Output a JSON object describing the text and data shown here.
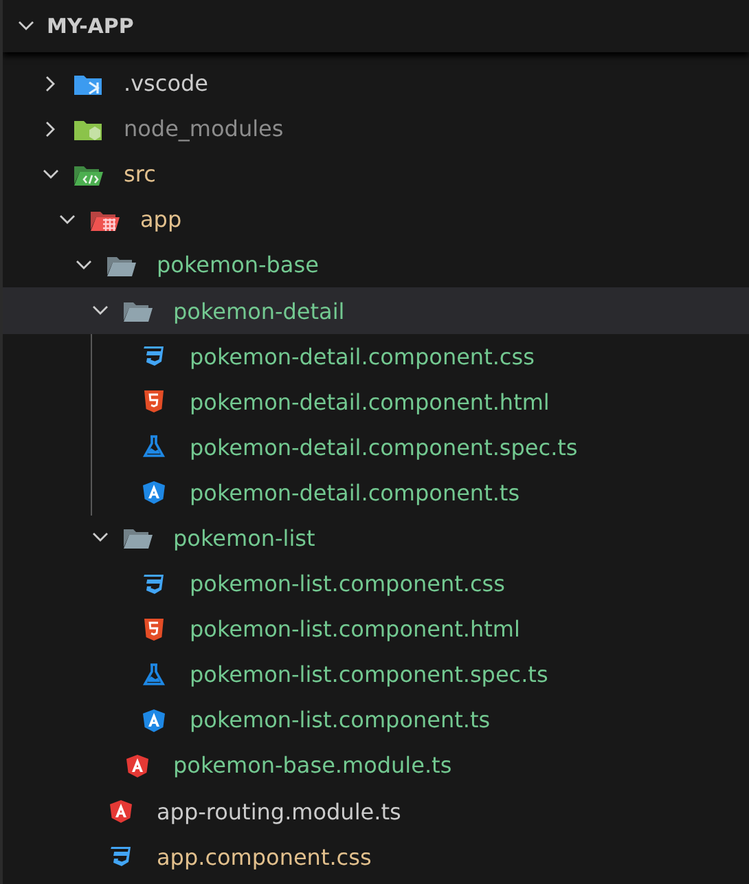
{
  "explorer": {
    "title": "MY-APP",
    "expanded": true
  },
  "tree": [
    {
      "name": ".vscode",
      "kind": "vscode-folder",
      "expanded": false,
      "selected": false,
      "color": "#cccccc"
    },
    {
      "name": "node_modules",
      "kind": "node-folder",
      "expanded": false,
      "selected": false,
      "color": "#8c8c8c"
    },
    {
      "name": "src",
      "kind": "src-folder",
      "expanded": true,
      "selected": false,
      "color": "#e2c08d",
      "children": [
        {
          "name": "app",
          "kind": "app-folder",
          "expanded": true,
          "selected": false,
          "color": "#e2c08d",
          "children": [
            {
              "name": "pokemon-base",
              "kind": "folder",
              "expanded": true,
              "selected": false,
              "color": "#73c991",
              "children": [
                {
                  "name": "pokemon-detail",
                  "kind": "folder",
                  "expanded": true,
                  "selected": true,
                  "color": "#73c991",
                  "children": [
                    {
                      "name": "pokemon-detail.component.css",
                      "kind": "css-file",
                      "selected": false,
                      "color": "#73c991"
                    },
                    {
                      "name": "pokemon-detail.component.html",
                      "kind": "html-file",
                      "selected": false,
                      "color": "#73c991"
                    },
                    {
                      "name": "pokemon-detail.component.spec.ts",
                      "kind": "spec-file",
                      "selected": false,
                      "color": "#73c991"
                    },
                    {
                      "name": "pokemon-detail.component.ts",
                      "kind": "component-file",
                      "selected": false,
                      "color": "#73c991"
                    }
                  ]
                },
                {
                  "name": "pokemon-list",
                  "kind": "folder",
                  "expanded": true,
                  "selected": false,
                  "color": "#73c991",
                  "children": [
                    {
                      "name": "pokemon-list.component.css",
                      "kind": "css-file",
                      "selected": false,
                      "color": "#73c991"
                    },
                    {
                      "name": "pokemon-list.component.html",
                      "kind": "html-file",
                      "selected": false,
                      "color": "#73c991"
                    },
                    {
                      "name": "pokemon-list.component.spec.ts",
                      "kind": "spec-file",
                      "selected": false,
                      "color": "#73c991"
                    },
                    {
                      "name": "pokemon-list.component.ts",
                      "kind": "component-file",
                      "selected": false,
                      "color": "#73c991"
                    }
                  ]
                },
                {
                  "name": "pokemon-base.module.ts",
                  "kind": "module-file",
                  "selected": false,
                  "color": "#73c991"
                }
              ]
            },
            {
              "name": "app-routing.module.ts",
              "kind": "module-file",
              "selected": false,
              "color": "#cccccc"
            },
            {
              "name": "app.component.css",
              "kind": "css-file",
              "selected": false,
              "color": "#e2c08d"
            }
          ]
        }
      ]
    }
  ]
}
